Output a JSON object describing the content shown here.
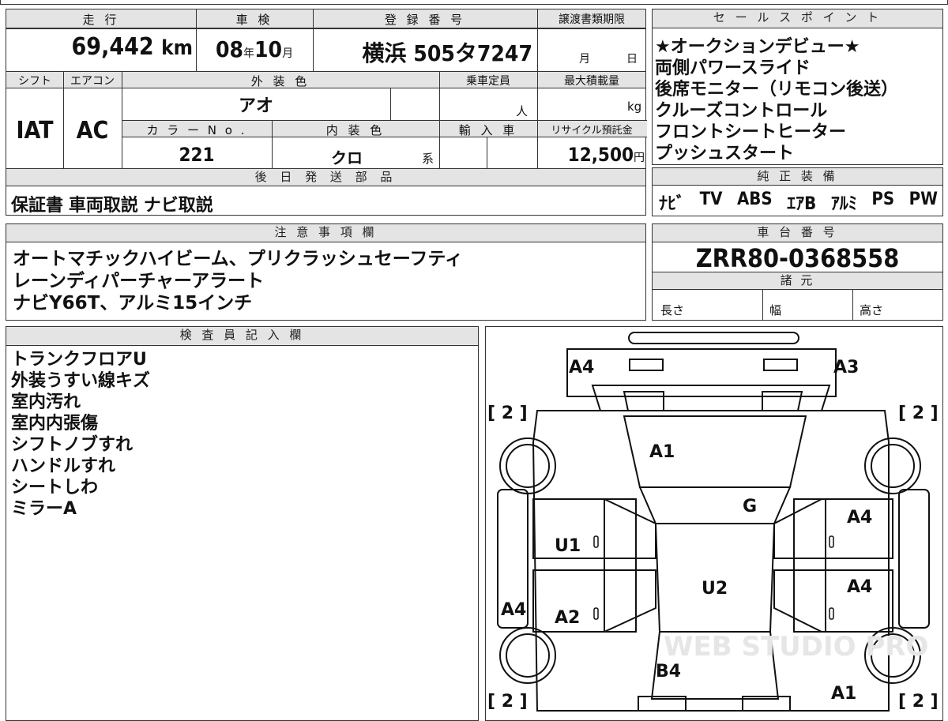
{
  "header": {
    "mileage_label": "走 行",
    "inspection_label": "車 検",
    "registration_label": "登 録 番 号",
    "transfer_deadline_label": "譲渡書類期限",
    "shift_label": "シフト",
    "aircon_label": "エアコン",
    "exterior_color_label": "外 装 色",
    "capacity_label": "乗車定員",
    "max_load_label": "最大積載量",
    "color_no_label": "カ ラ ー N o .",
    "interior_color_label": "内 装 色",
    "import_label": "輸 入 車",
    "recycle_label": "リサイクル預託金",
    "later_parts_label": "後 日 発 送 部 品"
  },
  "vehicle": {
    "mileage": "69,442",
    "mileage_unit": "km",
    "inspection_year": "08",
    "year_unit": "年",
    "inspection_month": "10",
    "month_unit": "月",
    "registration": "横浜 505タ7247",
    "deadline_month_unit": "月",
    "deadline_day_unit": "日",
    "shift": "IAT",
    "aircon": "AC",
    "exterior_color": "アオ",
    "capacity_unit": "人",
    "load_unit": "kg",
    "color_no": "221",
    "interior_color": "クロ",
    "interior_suffix": "系",
    "recycle_fee": "12,500",
    "recycle_unit": "円",
    "later_parts": "保証書 車両取説 ナビ取説"
  },
  "sales_points": {
    "label": "セ ー ル ス ポ イ ン ト",
    "items": [
      "★オークションデビュー★",
      "両側パワースライド",
      "後席モニター（リモコン後送）",
      "クルーズコントロール",
      "フロントシートヒーター",
      "プッシュスタート"
    ]
  },
  "equipment": {
    "label": "純 正 装 備",
    "items": [
      "ﾅﾋﾞ",
      "TV",
      "ABS",
      "ｴｱB",
      "ｱﾙﾐ",
      "PS",
      "PW"
    ]
  },
  "notes": {
    "label": "注 意 事 項 欄",
    "lines": [
      "オートマチックハイビーム、プリクラッシュセーフティ",
      "レーンディパーチャーアラート",
      "ナビY66T、アルミ15インチ"
    ]
  },
  "chassis": {
    "label": "車 台 番 号",
    "number": "ZRR80-0368558",
    "specs_label": "諸 元",
    "length_label": "長さ",
    "width_label": "幅",
    "height_label": "高さ"
  },
  "inspector": {
    "label": "検 査 員 記 入 欄",
    "lines": [
      "トランクフロアU",
      "外装うすい線キズ",
      "室内汚れ",
      "室内内張傷",
      "シフトノブすれ",
      "ハンドルすれ",
      "シートしわ",
      "ミラーA"
    ]
  },
  "diagram": {
    "tire_label": "[ 2 ]",
    "marks": {
      "rear_left": "A4",
      "rear_right": "A3",
      "hood": "A1",
      "windshield": "G",
      "front_left_door": "U1",
      "front_left_zero": "0",
      "rear_left_door": "A2",
      "rear_left_zero": "0",
      "right_front_door": "A4",
      "right_front_zero": "0",
      "right_rear_door": "A4",
      "right_rear_zero": "0",
      "roof": "U2",
      "left_quarter": "A4",
      "bumper_front": "B4",
      "right_front_fender": "A1"
    },
    "watermark": "WEB STUDIO PRO"
  }
}
